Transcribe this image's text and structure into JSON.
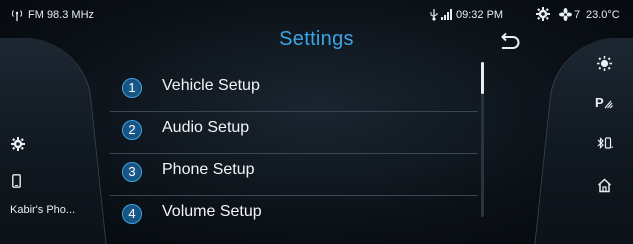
{
  "status_bar": {
    "radio": "FM 98.3 MHz",
    "time": "09:32 PM",
    "fan_speed": "7",
    "temperature": "23.0°C",
    "icons": [
      "radio-antenna-icon",
      "usb-icon",
      "signal-icon",
      "gear-icon",
      "fan-icon"
    ]
  },
  "settings": {
    "title": "Settings",
    "items": [
      {
        "number": "1",
        "label": "Vehicle Setup"
      },
      {
        "number": "2",
        "label": "Audio Setup"
      },
      {
        "number": "3",
        "label": "Phone Setup"
      },
      {
        "number": "4",
        "label": "Volume Setup"
      }
    ]
  },
  "left_panel": {
    "phone_name": "Kabir's Pho...",
    "icons": [
      "gear-icon",
      "phone-icon"
    ]
  },
  "right_panel": {
    "icons": [
      "brightness-icon",
      "parking-icon",
      "bluetooth-phone-icon",
      "home-icon"
    ]
  },
  "colors": {
    "accent": "#3da4e6",
    "background": "#0b1117"
  }
}
